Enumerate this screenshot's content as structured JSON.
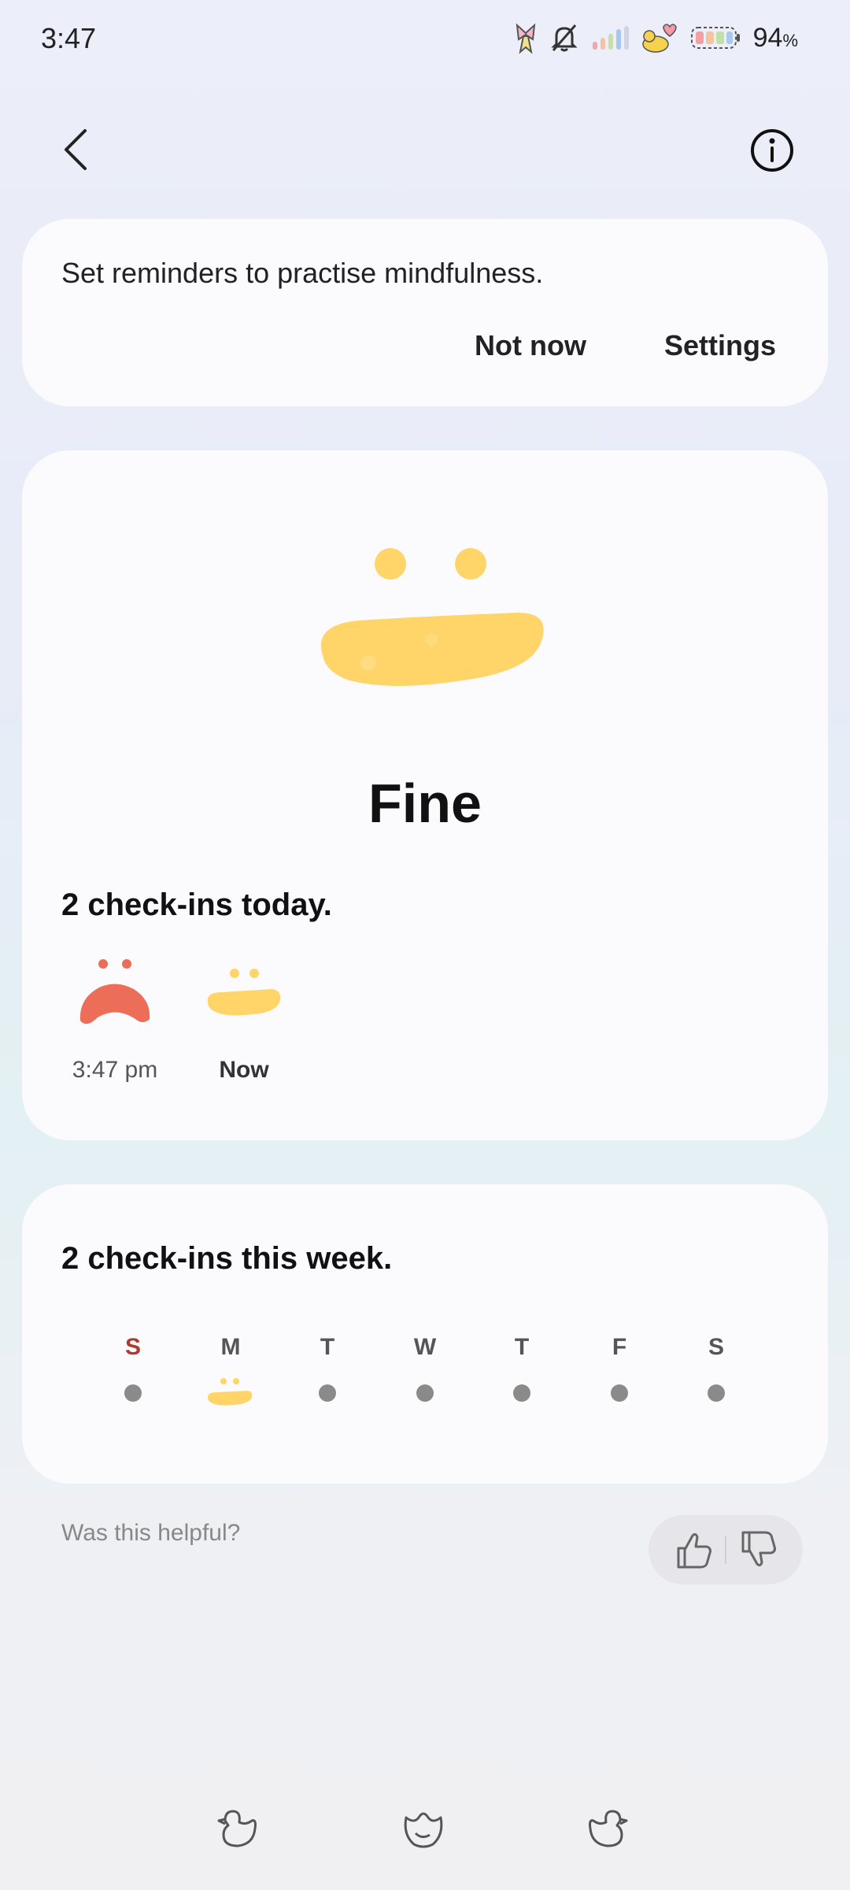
{
  "status_bar": {
    "time": "3:47",
    "battery_percent": "94",
    "battery_unit": "%"
  },
  "nav": {
    "back_icon": "chevron-left-icon",
    "info_icon": "info-icon"
  },
  "reminder": {
    "text": "Set reminders to practise mindfulness.",
    "not_now_label": "Not now",
    "settings_label": "Settings"
  },
  "today": {
    "mood": "Fine",
    "heading": "2 check-ins today.",
    "checkins": [
      {
        "time": "3:47 pm",
        "mood_icon": "sad-face-icon",
        "color": "#ec6e58"
      },
      {
        "time": "Now",
        "mood_icon": "fine-face-icon",
        "color": "#ffcf5a"
      }
    ]
  },
  "week": {
    "heading": "2 check-ins this week.",
    "days": [
      "S",
      "M",
      "T",
      "W",
      "T",
      "F",
      "S"
    ],
    "sunday_color": "#b0392d"
  },
  "feedback": {
    "question": "Was this helpful?"
  },
  "colors": {
    "fine_yellow": "#ffd469",
    "sad_red": "#ec6e58",
    "card_bg": "#fbfbfd"
  }
}
